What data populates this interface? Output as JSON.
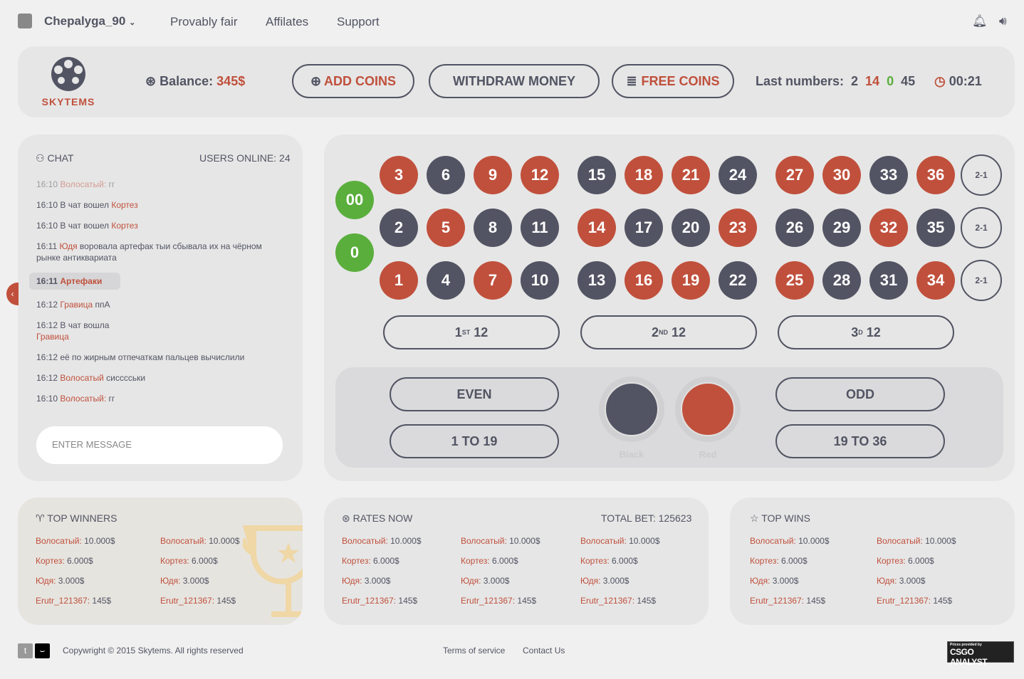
{
  "topbar": {
    "username": "Chepalyga_90",
    "nav": [
      "Provably fair",
      "Affilates",
      "Support"
    ]
  },
  "header": {
    "logo_text": "SKYTEMS",
    "balance_label": "Balance:",
    "balance_value": "345$",
    "add_coins": "ADD COINS",
    "withdraw": "WITHDRAW MONEY",
    "free_coins": "FREE COINS",
    "last_numbers_label": "Last numbers:",
    "last_numbers": [
      {
        "v": "2",
        "c": "#525463"
      },
      {
        "v": "14",
        "c": "#c0503c"
      },
      {
        "v": "0",
        "c": "#5aae3c"
      },
      {
        "v": "45",
        "c": "#525463"
      }
    ],
    "timer": "00:21"
  },
  "chat": {
    "title": "CHAT",
    "users_online": "USERS ONLINE: 24",
    "placeholder": "ENTER MESSAGE",
    "messages": [
      {
        "time": "16:10",
        "pre": "",
        "name": "Волосатый:",
        "text": " гг"
      },
      {
        "time": "16:10",
        "pre": "В чат вошел ",
        "name": "Кортез",
        "text": ""
      },
      {
        "time": "16:10",
        "pre": "В чат вошел ",
        "name": "Кортез",
        "text": ""
      },
      {
        "time": "16:11",
        "pre": "",
        "name": "Юдя",
        "text": " воровала артефак тыи сбывала их на чёрном рынке антиквариата"
      },
      {
        "time": "16:11",
        "pre": "",
        "name": "Артефаки",
        "text": ""
      },
      {
        "time": "16:12",
        "pre": "",
        "name": "Гравица",
        "text": " ппА"
      },
      {
        "time": "16:12",
        "pre": "В чат вошла ",
        "name": "Гравица",
        "text": ""
      },
      {
        "time": "16:12",
        "pre": "её по жирным отпечаткам пальцев вычислили",
        "name": "",
        "text": ""
      },
      {
        "time": "16:12",
        "pre": "",
        "name": "Волосатый",
        "text": " сисссськи"
      },
      {
        "time": "16:10",
        "pre": "",
        "name": "Волосатый:",
        "text": " гг"
      }
    ]
  },
  "board": {
    "rows": [
      [
        3,
        6,
        9,
        12,
        15,
        18,
        21,
        24,
        27,
        30,
        33,
        36
      ],
      [
        2,
        5,
        8,
        11,
        14,
        17,
        20,
        23,
        26,
        29,
        32,
        35
      ],
      [
        1,
        4,
        7,
        10,
        13,
        16,
        19,
        22,
        25,
        28,
        31,
        34
      ]
    ],
    "red": [
      1,
      3,
      5,
      7,
      9,
      12,
      14,
      16,
      18,
      19,
      21,
      23,
      25,
      27,
      30,
      32,
      34,
      36
    ],
    "zeros": [
      "00",
      "0"
    ],
    "column_bet": "2-1",
    "dozens": [
      {
        "n": "1",
        "sup": "ST",
        "t": " 12"
      },
      {
        "n": "2",
        "sup": "ND",
        "t": " 12"
      },
      {
        "n": "3",
        "sup": "D",
        "t": " 12"
      }
    ],
    "even": "EVEN",
    "odd": "ODD",
    "low": "1 TO 19",
    "high": "19 TO 36",
    "black": "Black",
    "red_label": "Red"
  },
  "colors": {
    "red": "#c0503c",
    "black": "#525463",
    "green": "#5aae3c"
  },
  "top_winners": {
    "title": "TOP WINNERS",
    "cols": [
      [
        [
          "Волосатый:",
          " 10.000$"
        ],
        [
          "Кортез:",
          " 6.000$"
        ],
        [
          "Юдя:",
          " 3.000$"
        ],
        [
          "Erutr_121367:",
          " 145$"
        ]
      ],
      [
        [
          "Волосатый:",
          " 10.000$"
        ],
        [
          "Кортез:",
          " 6.000$"
        ],
        [
          "Юдя:",
          " 3.000$"
        ],
        [
          "Erutr_121367:",
          " 145$"
        ]
      ]
    ]
  },
  "rates": {
    "title": "RATES NOW",
    "total": "TOTAL BET: 125623",
    "cols": [
      [
        [
          "Волосатый:",
          " 10.000$"
        ],
        [
          "Кортез:",
          " 6.000$"
        ],
        [
          "Юдя:",
          " 3.000$"
        ],
        [
          "Erutr_121367:",
          " 145$"
        ]
      ],
      [
        [
          "Волосатый:",
          " 10.000$"
        ],
        [
          "Кортез:",
          " 6.000$"
        ],
        [
          "Юдя:",
          " 3.000$"
        ],
        [
          "Erutr_121367:",
          " 145$"
        ]
      ],
      [
        [
          "Волосатый:",
          " 10.000$"
        ],
        [
          "Кортез:",
          " 6.000$"
        ],
        [
          "Юдя:",
          " 3.000$"
        ],
        [
          "Erutr_121367:",
          " 145$"
        ]
      ]
    ]
  },
  "top_wins": {
    "title": "TOP WINS",
    "cols": [
      [
        [
          "Волосатый:",
          " 10.000$"
        ],
        [
          "Кортез:",
          " 6.000$"
        ],
        [
          "Юдя:",
          " 3.000$"
        ],
        [
          "Erutr_121367:",
          " 145$"
        ]
      ],
      [
        [
          "Волосатый:",
          " 10.000$"
        ],
        [
          "Кортез:",
          " 6.000$"
        ],
        [
          "Юдя:",
          " 3.000$"
        ],
        [
          "Erutr_121367:",
          " 145$"
        ]
      ]
    ]
  },
  "footer": {
    "copyright": "Copywright © 2015 Skytems. All rights reserved",
    "terms": "Terms of service",
    "contact": "Contact Us",
    "badge_small": "Prices provided by",
    "badge": "CSGO ANALYST"
  }
}
